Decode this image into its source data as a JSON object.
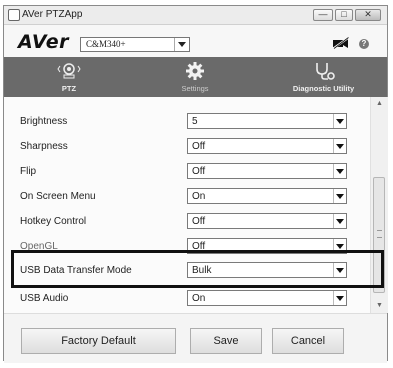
{
  "window": {
    "title": "AVer PTZApp"
  },
  "window_controls": {
    "minimize": "—",
    "maximize": "□",
    "close": "✕"
  },
  "brand": {
    "logo": "AVer",
    "model_select": "C&M340+",
    "help": "?"
  },
  "tabs": [
    {
      "label": "PTZ",
      "icon": "camera-icon"
    },
    {
      "label": "Settings",
      "icon": "gear-icon",
      "selected": true
    },
    {
      "label": "Diagnostic Utility",
      "icon": "stethoscope-icon"
    }
  ],
  "settings": [
    {
      "label": "Brightness",
      "value": "5"
    },
    {
      "label": "Sharpness",
      "value": "Off"
    },
    {
      "label": "Flip",
      "value": "Off"
    },
    {
      "label": "On Screen Menu",
      "value": "On"
    },
    {
      "label": "Hotkey Control",
      "value": "Off"
    },
    {
      "label": "OpenGL",
      "value": "Off"
    },
    {
      "label": "USB Data Transfer Mode",
      "value": "Bulk"
    },
    {
      "label": "USB Audio",
      "value": "On"
    }
  ],
  "scrollbar": {
    "up": "▲",
    "down": "▼"
  },
  "footer": {
    "factory_default": "Factory Default",
    "save": "Save",
    "cancel": "Cancel"
  },
  "colors": {
    "tab_bar": "#6a6a6a",
    "highlight_border": "#111111"
  }
}
